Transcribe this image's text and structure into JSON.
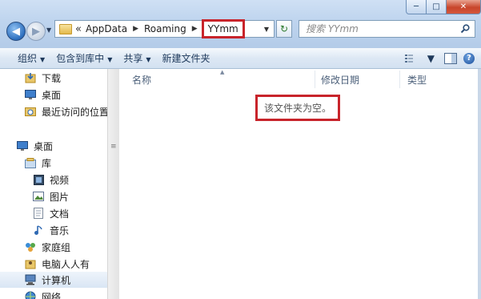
{
  "window": {
    "minimize_glyph": "─",
    "maximize_glyph": "□",
    "close_glyph": "✕"
  },
  "nav": {
    "back_glyph": "◀",
    "forward_glyph": "▶",
    "dropdown_glyph": "▼"
  },
  "address": {
    "overflow_glyph": "«",
    "crumbs": [
      "AppData",
      "Roaming"
    ],
    "current": "YYmm",
    "separator_glyph": "▶",
    "dropdown_glyph": "▼"
  },
  "refresh_glyph": "↻",
  "search": {
    "placeholder": "搜索 YYmm"
  },
  "toolbar": {
    "organize": "组织",
    "include_in_library": "包含到库中",
    "share": "共享",
    "new_folder": "新建文件夹",
    "dropdown_glyph": "▼",
    "help_glyph": "?"
  },
  "sidebar": {
    "favorites": [
      {
        "label": "下载",
        "icon": "download-folder-icon"
      },
      {
        "label": "桌面",
        "icon": "desktop-icon"
      },
      {
        "label": "最近访问的位置",
        "icon": "recent-places-icon"
      }
    ],
    "desktop": {
      "label": "桌面",
      "icon": "desktop-icon"
    },
    "library": {
      "label": "库",
      "icon": "library-icon"
    },
    "library_items": [
      {
        "label": "视频",
        "icon": "video-icon"
      },
      {
        "label": "图片",
        "icon": "picture-icon"
      },
      {
        "label": "文档",
        "icon": "document-icon"
      },
      {
        "label": "音乐",
        "icon": "music-icon"
      }
    ],
    "homegroup": {
      "label": "家庭组",
      "icon": "homegroup-icon"
    },
    "user": {
      "label": "电脑人人有",
      "icon": "user-folder-icon"
    },
    "computer": {
      "label": "计算机",
      "icon": "computer-icon"
    },
    "network": {
      "label": "网络",
      "icon": "network-icon"
    }
  },
  "columns": {
    "name": "名称",
    "modified": "修改日期",
    "type": "类型"
  },
  "empty_message": "该文件夹为空。",
  "colors": {
    "highlight_box": "#c8242b",
    "chrome_top": "#cfe0f4",
    "toolbar_text": "#1e395b"
  }
}
